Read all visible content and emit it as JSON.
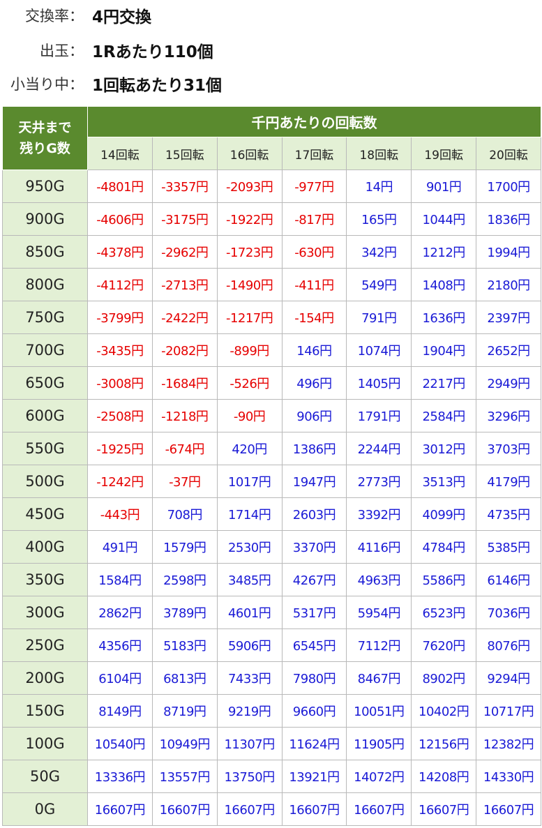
{
  "info": {
    "exchange_label": "交換率：",
    "exchange_value": "4円交換",
    "payout_label": "出玉：",
    "payout_value": "1Rあたり110個",
    "small_hit_label": "小当り中：",
    "small_hit_value": "1回転あたり31個"
  },
  "table": {
    "corner_line1": "天井まで",
    "corner_line2": "残りG数",
    "group_header": "千円あたりの回転数",
    "spin_headers": [
      "14回転",
      "15回転",
      "16回転",
      "17回転",
      "18回転",
      "19回転",
      "20回転"
    ],
    "colors": {
      "header_bg": "#5a8a2e",
      "label_bg": "#e3f0d5",
      "negative": "#e60000",
      "positive": "#1a1ad6"
    },
    "rows": [
      {
        "remaining": "950G",
        "values": [
          "-4801円",
          "-3357円",
          "-2093円",
          "-977円",
          "14円",
          "901円",
          "1700円"
        ]
      },
      {
        "remaining": "900G",
        "values": [
          "-4606円",
          "-3175円",
          "-1922円",
          "-817円",
          "165円",
          "1044円",
          "1836円"
        ]
      },
      {
        "remaining": "850G",
        "values": [
          "-4378円",
          "-2962円",
          "-1723円",
          "-630円",
          "342円",
          "1212円",
          "1994円"
        ]
      },
      {
        "remaining": "800G",
        "values": [
          "-4112円",
          "-2713円",
          "-1490円",
          "-411円",
          "549円",
          "1408円",
          "2180円"
        ]
      },
      {
        "remaining": "750G",
        "values": [
          "-3799円",
          "-2422円",
          "-1217円",
          "-154円",
          "791円",
          "1636円",
          "2397円"
        ]
      },
      {
        "remaining": "700G",
        "values": [
          "-3435円",
          "-2082円",
          "-899円",
          "146円",
          "1074円",
          "1904円",
          "2652円"
        ]
      },
      {
        "remaining": "650G",
        "values": [
          "-3008円",
          "-1684円",
          "-526円",
          "496円",
          "1405円",
          "2217円",
          "2949円"
        ]
      },
      {
        "remaining": "600G",
        "values": [
          "-2508円",
          "-1218円",
          "-90円",
          "906円",
          "1791円",
          "2584円",
          "3296円"
        ]
      },
      {
        "remaining": "550G",
        "values": [
          "-1925円",
          "-674円",
          "420円",
          "1386円",
          "2244円",
          "3012円",
          "3703円"
        ]
      },
      {
        "remaining": "500G",
        "values": [
          "-1242円",
          "-37円",
          "1017円",
          "1947円",
          "2773円",
          "3513円",
          "4179円"
        ]
      },
      {
        "remaining": "450G",
        "values": [
          "-443円",
          "708円",
          "1714円",
          "2603円",
          "3392円",
          "4099円",
          "4735円"
        ]
      },
      {
        "remaining": "400G",
        "values": [
          "491円",
          "1579円",
          "2530円",
          "3370円",
          "4116円",
          "4784円",
          "5385円"
        ]
      },
      {
        "remaining": "350G",
        "values": [
          "1584円",
          "2598円",
          "3485円",
          "4267円",
          "4963円",
          "5586円",
          "6146円"
        ]
      },
      {
        "remaining": "300G",
        "values": [
          "2862円",
          "3789円",
          "4601円",
          "5317円",
          "5954円",
          "6523円",
          "7036円"
        ]
      },
      {
        "remaining": "250G",
        "values": [
          "4356円",
          "5183円",
          "5906円",
          "6545円",
          "7112円",
          "7620円",
          "8076円"
        ]
      },
      {
        "remaining": "200G",
        "values": [
          "6104円",
          "6813円",
          "7433円",
          "7980円",
          "8467円",
          "8902円",
          "9294円"
        ]
      },
      {
        "remaining": "150G",
        "values": [
          "8149円",
          "8719円",
          "9219円",
          "9660円",
          "10051円",
          "10402円",
          "10717円"
        ]
      },
      {
        "remaining": "100G",
        "values": [
          "10540円",
          "10949円",
          "11307円",
          "11624円",
          "11905円",
          "12156円",
          "12382円"
        ]
      },
      {
        "remaining": "50G",
        "values": [
          "13336円",
          "13557円",
          "13750円",
          "13921円",
          "14072円",
          "14208円",
          "14330円"
        ]
      },
      {
        "remaining": "0G",
        "values": [
          "16607円",
          "16607円",
          "16607円",
          "16607円",
          "16607円",
          "16607円",
          "16607円"
        ]
      }
    ]
  }
}
